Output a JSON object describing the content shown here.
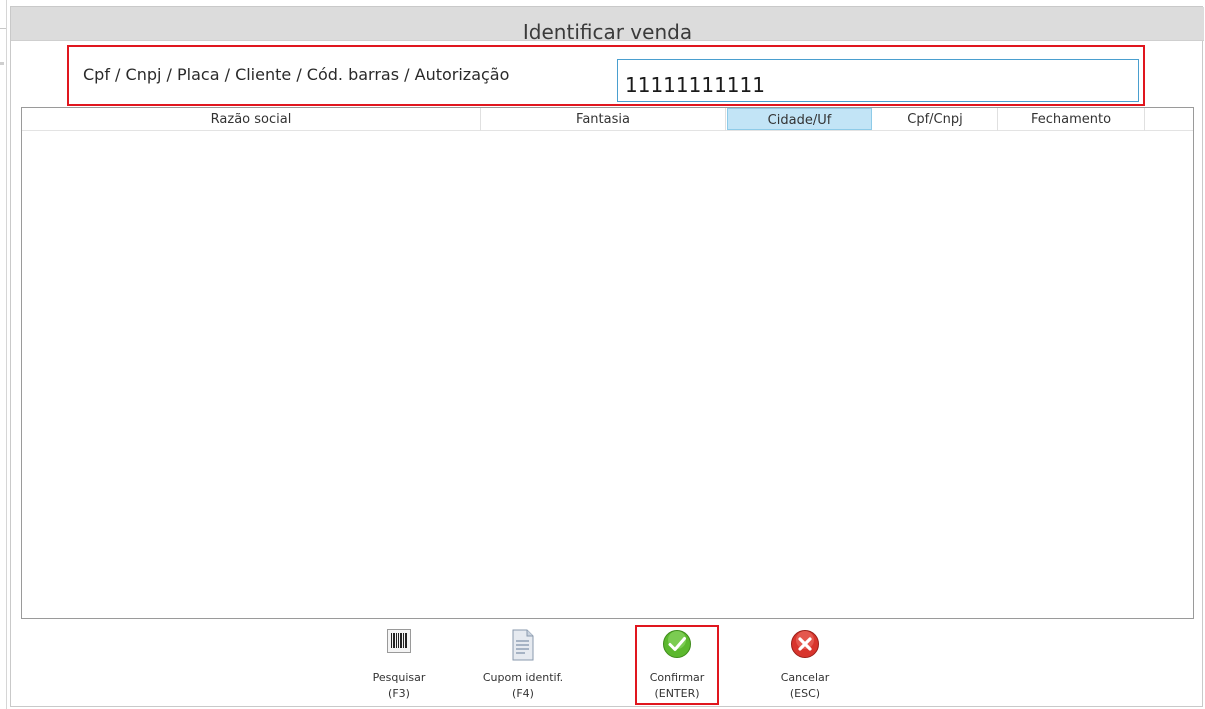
{
  "dialog": {
    "title": "Identificar venda"
  },
  "search": {
    "label": "Cpf / Cnpj / Placa / Cliente / Cód. barras / Autorização",
    "value": "11111111111"
  },
  "grid": {
    "columns": [
      "Razão social",
      "Fantasia",
      "Cidade/Uf",
      "Cpf/Cnpj",
      "Fechamento"
    ],
    "selected_column": "Cidade/Uf",
    "rows": []
  },
  "buttons": {
    "search": {
      "label": "Pesquisar\n(F3)",
      "icon": "barcode-icon"
    },
    "coupon": {
      "label": "Cupom identif.\n(F4)",
      "icon": "document-icon"
    },
    "confirm": {
      "label": "Confirmar\n(ENTER)",
      "icon": "check-icon"
    },
    "cancel": {
      "label": "Cancelar\n(ESC)",
      "icon": "close-icon"
    }
  },
  "colors": {
    "highlight": "#e0161e",
    "input_border": "#4a9fcf",
    "selected_column_bg": "#c2e4f6",
    "confirm_green": "#5cb82e",
    "cancel_red": "#d8352d"
  }
}
